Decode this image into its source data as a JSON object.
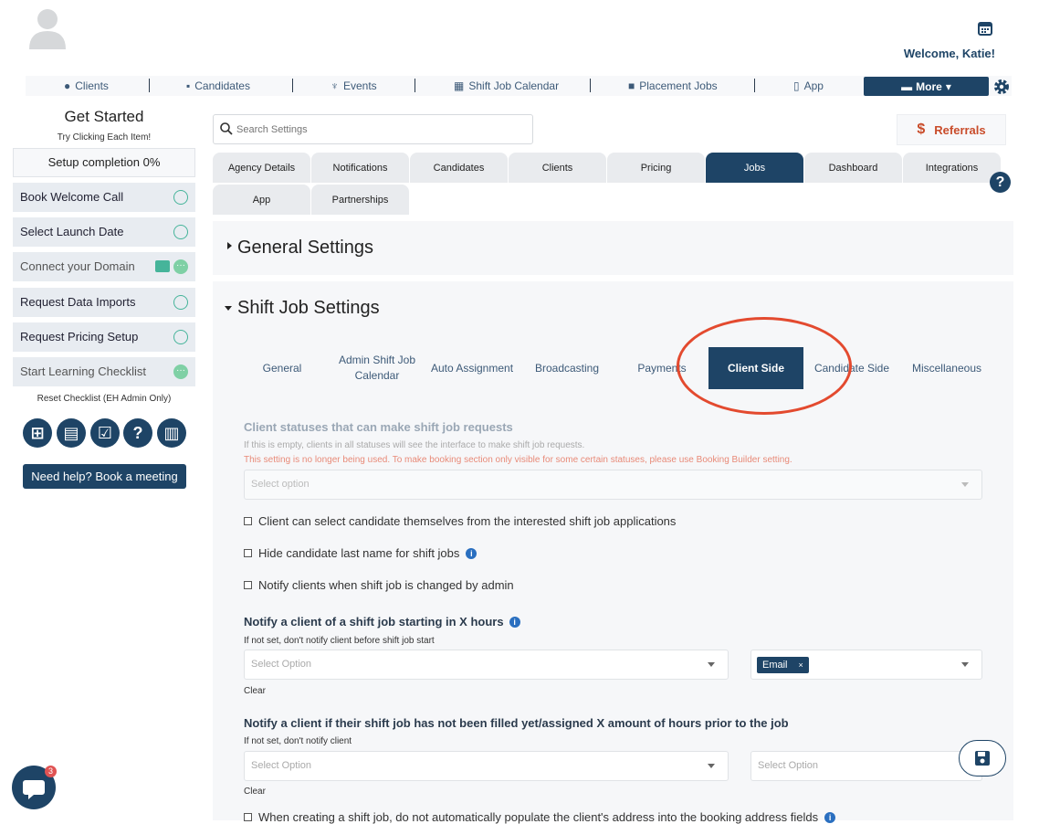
{
  "header": {
    "welcome": "Welcome, Katie!"
  },
  "nav": {
    "items": [
      {
        "label": "Clients",
        "icon": "globe-icon"
      },
      {
        "label": "Candidates",
        "icon": "id-badge-icon"
      },
      {
        "label": "Events",
        "icon": "trophy-icon"
      },
      {
        "label": "Shift Job Calendar",
        "icon": "calendar-icon"
      },
      {
        "label": "Placement Jobs",
        "icon": "briefcase-icon"
      },
      {
        "label": "App",
        "icon": "mobile-icon"
      }
    ],
    "more": "More"
  },
  "sidebar": {
    "title": "Get Started",
    "subtitle": "Try Clicking Each Item!",
    "completion": "Setup completion 0%",
    "items": [
      {
        "label": "Book Welcome Call"
      },
      {
        "label": "Select Launch Date"
      },
      {
        "label": "Connect your Domain"
      },
      {
        "label": "Request Data Imports"
      },
      {
        "label": "Request Pricing Setup"
      },
      {
        "label": "Start Learning Checklist"
      }
    ],
    "reset": "Reset Checklist (EH Admin Only)",
    "help_button": "Need help? Book a meeting"
  },
  "chat": {
    "badge": "3"
  },
  "search": {
    "placeholder": "Search Settings"
  },
  "referrals": {
    "label": "Referrals",
    "icon": "$"
  },
  "tabs": [
    "Agency Details",
    "Notifications",
    "Candidates",
    "Clients",
    "Pricing",
    "Jobs",
    "Dashboard",
    "Integrations",
    "App",
    "Partnerships"
  ],
  "active_tab": "Jobs",
  "sections": {
    "general": "General Settings",
    "shift": "Shift Job Settings"
  },
  "subtabs": [
    "General",
    "Admin Shift Job Calendar",
    "Auto Assignment",
    "Broadcasting",
    "Payments",
    "Client Side",
    "Candidate Side",
    "Miscellaneous"
  ],
  "active_subtab": "Client Side",
  "form": {
    "statuses": {
      "label": "Client statuses that can make shift job requests",
      "help": "If this is empty, clients in all statuses will see the interface to make shift job requests.",
      "warning": "This setting is no longer being used. To make booking section only visible for some certain statuses, please use Booking Builder setting.",
      "placeholder": "Select option"
    },
    "checkboxes": [
      "Client can select candidate themselves from the interested shift job applications",
      "Hide candidate last name for shift jobs",
      "Notify clients when shift job is changed by admin"
    ],
    "notify_x_hours": {
      "label": "Notify a client of a shift job starting in X hours",
      "help": "If not set, don't notify client before shift job start",
      "placeholder": "Select Option",
      "channel": "Email",
      "clear": "Clear"
    },
    "notify_not_filled": {
      "label": "Notify a client if their shift job has not been filled yet/assigned X amount of hours prior to the job",
      "help": "If not set, don't notify client",
      "placeholder": "Select Option",
      "placeholder2": "Select Option",
      "clear": "Clear"
    },
    "last_checkbox": "When creating a shift job, do not automatically populate the client's address into the booking address fields"
  },
  "colors": {
    "primary": "#1e4466",
    "accent": "#c94c2a",
    "success": "#46b49a",
    "highlight": "#e34a2f"
  }
}
